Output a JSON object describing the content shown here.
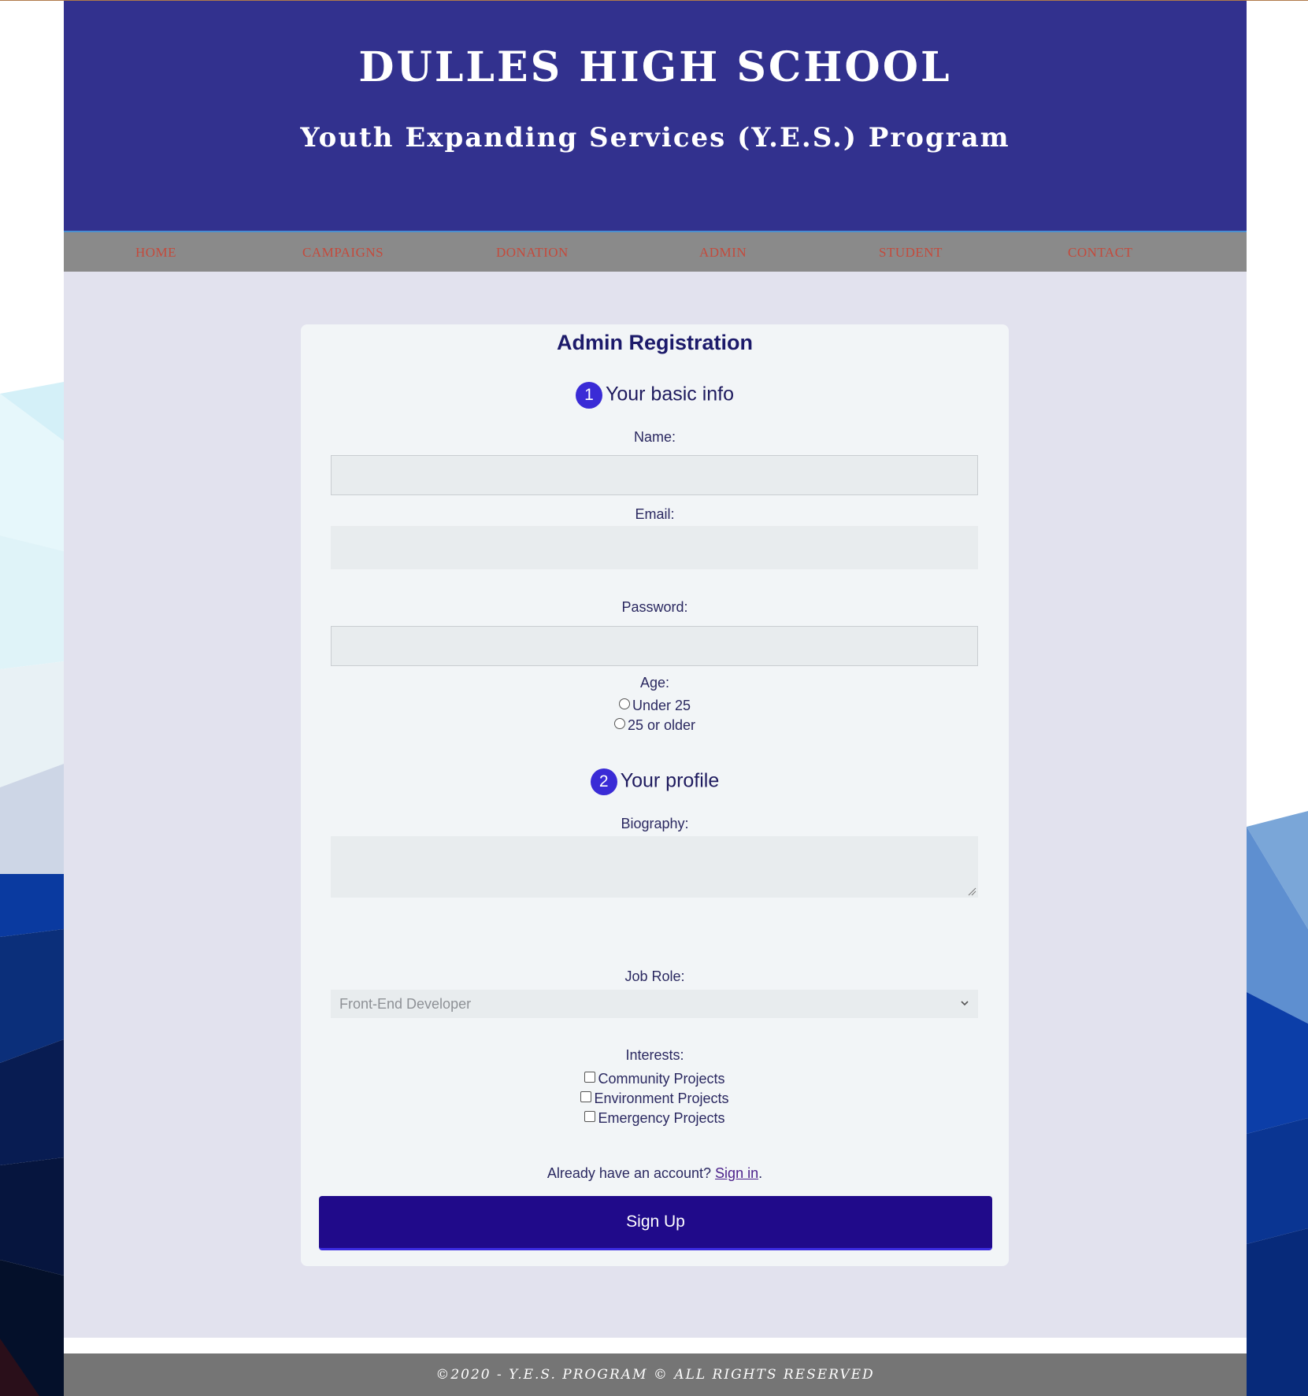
{
  "header": {
    "title": "DULLES HIGH SCHOOL",
    "subtitle": "Youth Expanding Services (Y.E.S.) Program"
  },
  "nav": {
    "items": [
      {
        "label": "HOME"
      },
      {
        "label": "CAMPAIGNS"
      },
      {
        "label": "DONATION"
      },
      {
        "label": "ADMIN"
      },
      {
        "label": "STUDENT"
      },
      {
        "label": "CONTACT"
      }
    ]
  },
  "form": {
    "title": "Admin Registration",
    "section1": {
      "number": "1",
      "heading": "Your basic info"
    },
    "name_label": "Name:",
    "name_value": "",
    "email_label": "Email:",
    "email_value": "",
    "password_label": "Password:",
    "password_value": "",
    "age_label": "Age:",
    "age_options": [
      {
        "label": "Under 25",
        "selected": false
      },
      {
        "label": "25 or older",
        "selected": false
      }
    ],
    "section2": {
      "number": "2",
      "heading": "Your profile"
    },
    "biography_label": "Biography:",
    "biography_value": "",
    "job_role_label": "Job Role:",
    "job_role_selected": "Front-End Developer",
    "interests_label": "Interests:",
    "interests": [
      {
        "label": "Community Projects",
        "checked": false
      },
      {
        "label": "Environment Projects",
        "checked": false
      },
      {
        "label": "Emergency Projects",
        "checked": false
      }
    ],
    "account_prompt": "Already have an account?",
    "signin_link": "Sign in",
    "signin_suffix": ".",
    "signup_button": "Sign Up"
  },
  "footer": {
    "text": "©2020 - Y.E.S. PROGRAM © ALL RIGHTS RESERVED"
  },
  "colors": {
    "header_bg": "#32318e",
    "nav_bg": "#8a8a8a",
    "nav_link": "#c44a3c",
    "main_bg": "#e2e2ee",
    "card_bg": "#f2f5f7",
    "step_badge": "#3a2bd6",
    "signup_button": "#200a8a",
    "footer_bg": "#757575"
  },
  "icons": {
    "step_badge": "numbered-circle",
    "select_chevron": "chevron-down-icon",
    "textarea_grip": "resize-grip-icon"
  }
}
